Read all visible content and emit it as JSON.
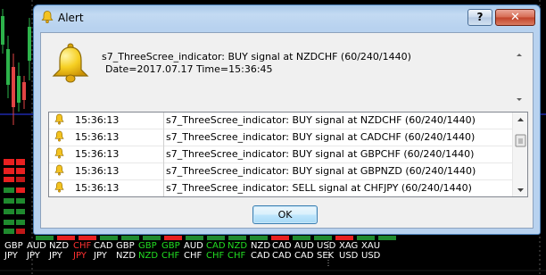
{
  "window": {
    "title": "Alert",
    "help_glyph": "?",
    "close_glyph": "✕"
  },
  "message": {
    "line1": "s7_ThreeScree_indicator: BUY signal at NZDCHF (60/240/1440)",
    "line2": "Date=2017.07.17 Time=15:36:45"
  },
  "alerts": [
    {
      "time": "15:36:13",
      "text": "s7_ThreeScree_indicator: BUY signal at NZDCHF (60/240/1440)"
    },
    {
      "time": "15:36:13",
      "text": "s7_ThreeScree_indicator: BUY signal at CADCHF (60/240/1440)"
    },
    {
      "time": "15:36:13",
      "text": "s7_ThreeScree_indicator: BUY signal at GBPCHF (60/240/1440)"
    },
    {
      "time": "15:36:13",
      "text": "s7_ThreeScree_indicator: BUY signal at GBPNZD (60/240/1440)"
    },
    {
      "time": "15:36:13",
      "text": "s7_ThreeScree_indicator: SELL signal at CHFJPY (60/240/1440)"
    }
  ],
  "ok_label": "OK",
  "pairs_row1": [
    {
      "text": "GBP",
      "color": "#ffffff"
    },
    {
      "text": "AUD",
      "color": "#ffffff"
    },
    {
      "text": "NZD",
      "color": "#ffffff"
    },
    {
      "text": "CHF",
      "color": "#ff3030"
    },
    {
      "text": "CAD",
      "color": "#ffffff"
    },
    {
      "text": "GBP",
      "color": "#ffffff"
    },
    {
      "text": "GBP",
      "color": "#22dd22"
    },
    {
      "text": "GBP",
      "color": "#22dd22"
    },
    {
      "text": "AUD",
      "color": "#ffffff"
    },
    {
      "text": "CAD",
      "color": "#22dd22"
    },
    {
      "text": "NZD",
      "color": "#22dd22"
    },
    {
      "text": "NZD",
      "color": "#ffffff"
    },
    {
      "text": "CAD",
      "color": "#ffffff"
    },
    {
      "text": "AUD",
      "color": "#ffffff"
    },
    {
      "text": "USD",
      "color": "#ffffff"
    },
    {
      "text": "XAG",
      "color": "#ffffff"
    },
    {
      "text": "XAU",
      "color": "#ffffff"
    }
  ],
  "pairs_row2": [
    {
      "text": "JPY",
      "color": "#ffffff"
    },
    {
      "text": "JPY",
      "color": "#ffffff"
    },
    {
      "text": "JPY",
      "color": "#ffffff"
    },
    {
      "text": "JPY",
      "color": "#ff3030"
    },
    {
      "text": "JPY",
      "color": "#ffffff"
    },
    {
      "text": "NZD",
      "color": "#ffffff"
    },
    {
      "text": "NZD",
      "color": "#22dd22"
    },
    {
      "text": "CHF",
      "color": "#22dd22"
    },
    {
      "text": "CHF",
      "color": "#ffffff"
    },
    {
      "text": "CHF",
      "color": "#22dd22"
    },
    {
      "text": "CHF",
      "color": "#22dd22"
    },
    {
      "text": "CAD",
      "color": "#ffffff"
    },
    {
      "text": "CAD",
      "color": "#ffffff"
    },
    {
      "text": "CAD",
      "color": "#ffffff"
    },
    {
      "text": "SEK",
      "color": "#ffffff"
    },
    {
      "text": "USD",
      "color": "#ffffff"
    },
    {
      "text": "USD",
      "color": "#ffffff"
    }
  ]
}
